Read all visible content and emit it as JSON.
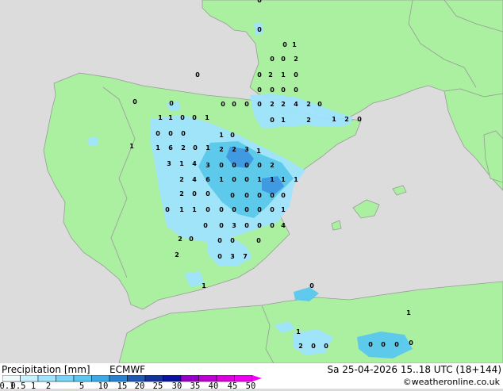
{
  "colors": {
    "sea": "#dcdcdc",
    "land": "#aaf0a0",
    "border": "#9a9a9a",
    "precip_light": "#a0e4ff",
    "precip_mid": "#5ac8f0",
    "precip_strong": "#3a96e6"
  },
  "footer": {
    "title_left": "Precipitation [mm]",
    "model": "ECMWF",
    "valid_time": "Sa 25-04-2026 15..18 UTC (18+144)",
    "credit": "©weatheronline.co.uk"
  },
  "legend": {
    "levels": [
      "0.1",
      "0.5",
      "1",
      "2",
      "5",
      "10",
      "15",
      "20",
      "25",
      "30",
      "35",
      "40",
      "45",
      "50"
    ],
    "colors": [
      "#f0fbff",
      "#c8f2ff",
      "#a0e4ff",
      "#78d4f8",
      "#5ac8f0",
      "#3caae6",
      "#2882d2",
      "#1e5ab4",
      "#14329b",
      "#0a14a0",
      "#9600c8",
      "#be00d2",
      "#dc00dc",
      "#f000f0"
    ]
  },
  "map_values": [
    "0",
    "0",
    "0",
    "0",
    "0",
    "0",
    "1",
    "0",
    "0",
    "2",
    "0",
    "2",
    "1",
    "0",
    "0",
    "0",
    "0",
    "0",
    "0",
    "0",
    "0",
    "0",
    "2",
    "2",
    "4",
    "2",
    "0",
    "1",
    "1",
    "0",
    "0",
    "1",
    "0",
    "1",
    "2",
    "1",
    "2",
    "0",
    "0",
    "0",
    "0",
    "1",
    "0",
    "1",
    "1",
    "6",
    "2",
    "0",
    "1",
    "2",
    "2",
    "3",
    "1",
    "3",
    "1",
    "4",
    "3",
    "0",
    "0",
    "0",
    "0",
    "2",
    "2",
    "4",
    "6",
    "1",
    "0",
    "0",
    "1",
    "1",
    "1",
    "1",
    "2",
    "0",
    "0",
    "0",
    "0",
    "0",
    "0",
    "0",
    "0",
    "1",
    "1",
    "0",
    "0",
    "0",
    "0",
    "0",
    "0",
    "1",
    "0",
    "0",
    "3",
    "0",
    "0",
    "0",
    "4",
    "2",
    "0",
    "0",
    "0",
    "0",
    "2",
    "0",
    "3",
    "7",
    "1",
    "0",
    "1",
    "1",
    "2"
  ]
}
